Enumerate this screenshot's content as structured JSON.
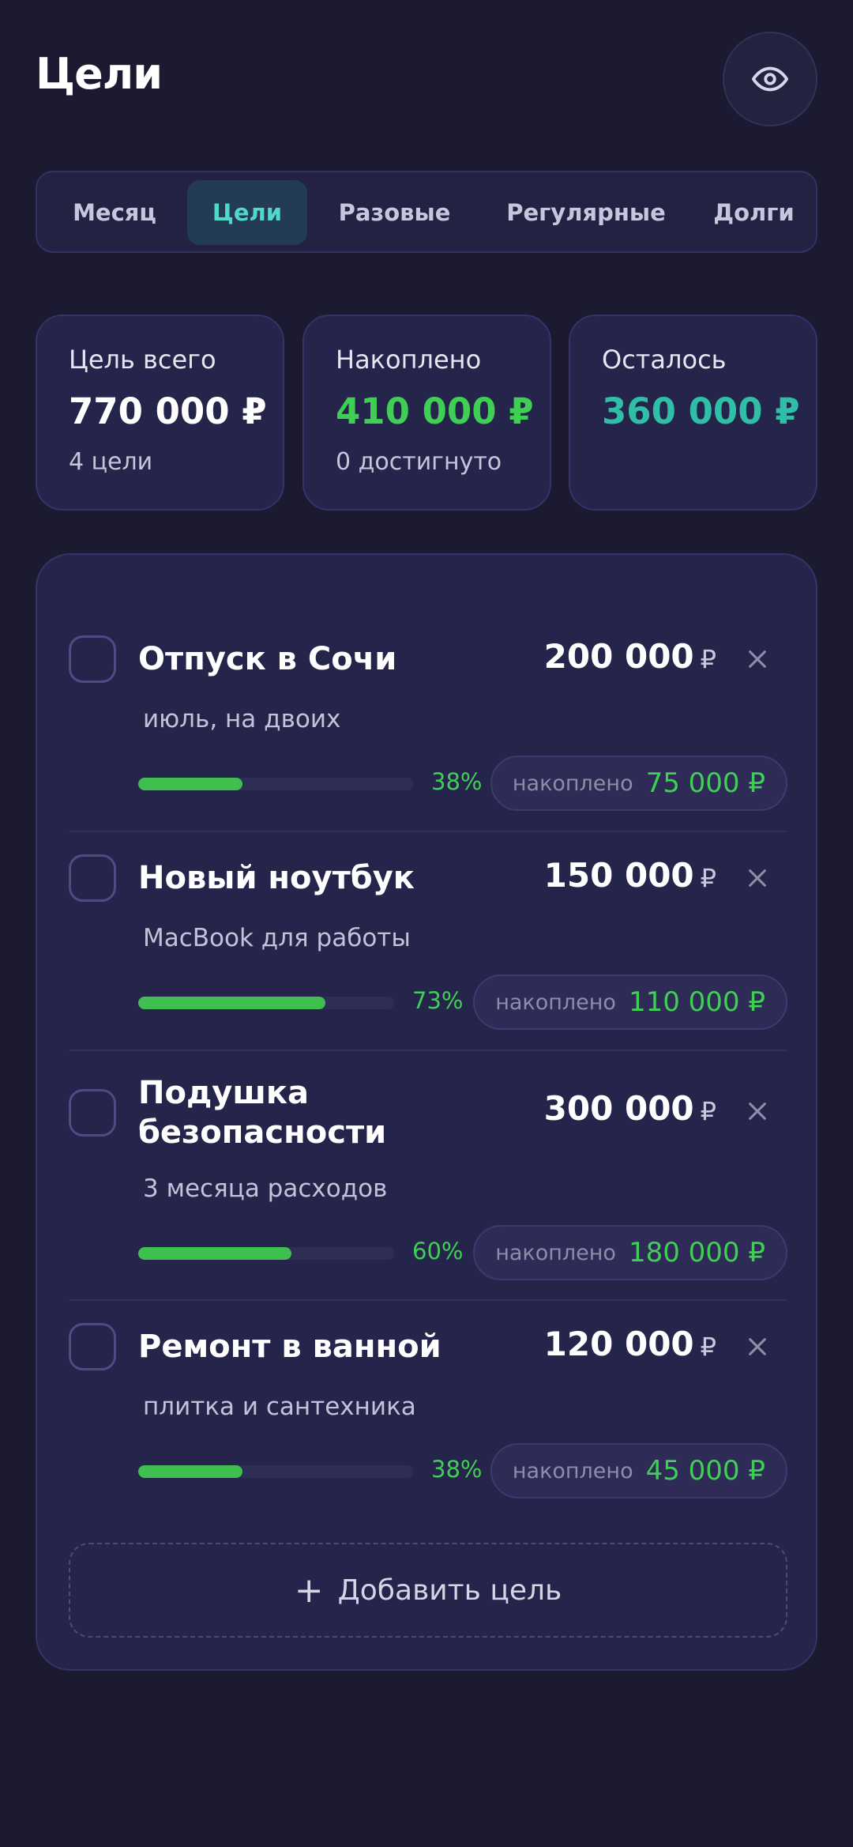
{
  "header": {
    "title": "Цели",
    "eye_icon": "eye-icon"
  },
  "tabs": [
    {
      "label": "Месяц",
      "active": false
    },
    {
      "label": "Цели",
      "active": true
    },
    {
      "label": "Разовые",
      "active": false
    },
    {
      "label": "Регулярные",
      "active": false
    },
    {
      "label": "Долги",
      "active": false
    }
  ],
  "summary": {
    "total": {
      "label": "Цель всего",
      "value": "770 000 ₽",
      "sub": "4 цели",
      "color": "#ffffff"
    },
    "saved": {
      "label": "Накоплено",
      "value": "410 000 ₽",
      "sub": "0 достигнуто",
      "color": "#3fcf55"
    },
    "left": {
      "label": "Осталось",
      "value": "360 000 ₽",
      "color": "#2fbfa6"
    }
  },
  "goals": [
    {
      "title": "Отпуск в Сочи",
      "amount": "200 000",
      "currency": "₽",
      "note": "июль, на двоих",
      "percent": "38%",
      "progress": 0.38,
      "saved_label": "накоплено",
      "saved_value": "75 000 ₽"
    },
    {
      "title": "Новый ноутбук",
      "amount": "150 000",
      "currency": "₽",
      "note": "MacBook для работы",
      "percent": "73%",
      "progress": 0.73,
      "saved_label": "накоплено",
      "saved_value": "110 000 ₽"
    },
    {
      "title": "Подушка безопасности",
      "amount": "300 000",
      "currency": "₽",
      "note": "3 месяца расходов",
      "percent": "60%",
      "progress": 0.6,
      "saved_label": "накоплено",
      "saved_value": "180 000 ₽"
    },
    {
      "title": "Ремонт в ванной",
      "amount": "120 000",
      "currency": "₽",
      "note": "плитка и сантехника",
      "percent": "38%",
      "progress": 0.38,
      "saved_label": "накоплено",
      "saved_value": "45 000 ₽"
    }
  ],
  "add_goal": {
    "label": "Добавить цель",
    "icon": "plus-icon"
  },
  "colors": {
    "accent": "#4fd9c6",
    "progress": "#3fbf4f",
    "background": "#1b1a30"
  }
}
